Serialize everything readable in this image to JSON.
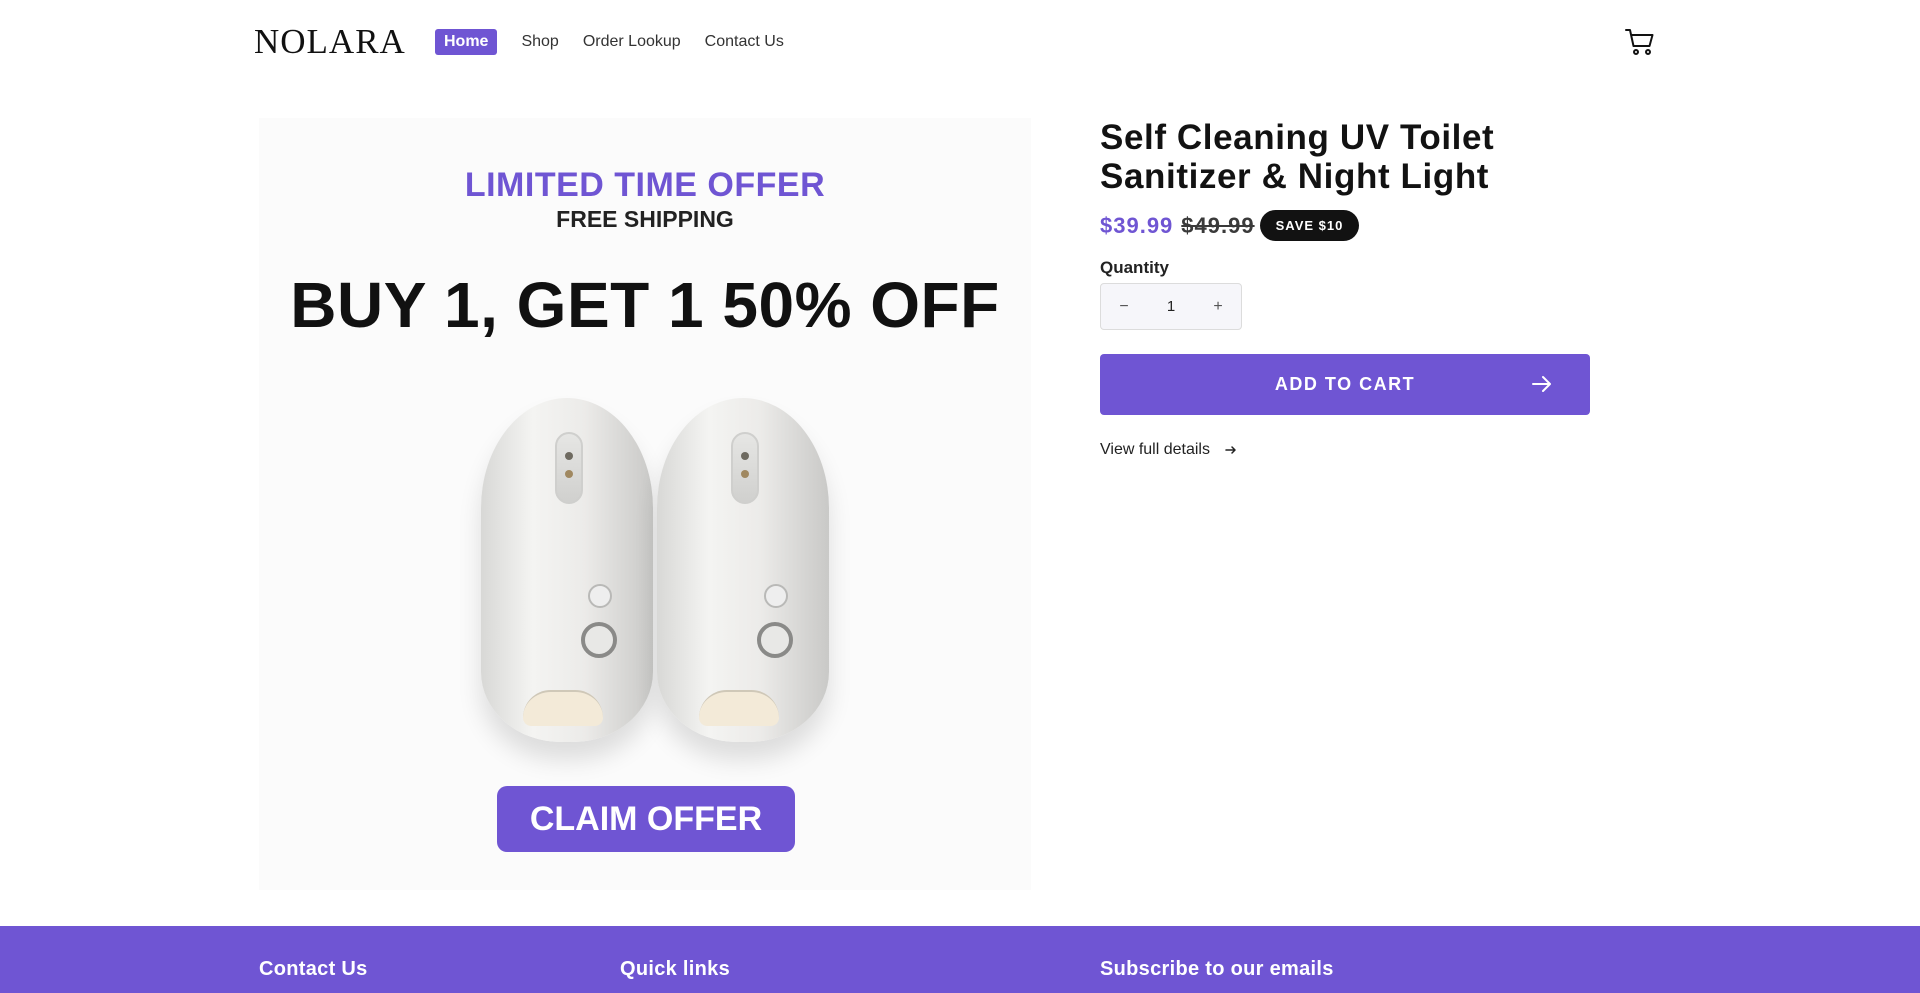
{
  "header": {
    "logo": "NOLARA",
    "nav": [
      {
        "label": "Home",
        "active": true
      },
      {
        "label": "Shop",
        "active": false
      },
      {
        "label": "Order Lookup",
        "active": false
      },
      {
        "label": "Contact Us",
        "active": false
      }
    ],
    "cart_icon": "shopping-cart-icon"
  },
  "product_image": {
    "line1": "LIMITED TIME OFFER",
    "line2": "FREE SHIPPING",
    "headline": "BUY 1, GET 1 50% OFF",
    "cta": "CLAIM OFFER"
  },
  "product": {
    "title": "Self Cleaning UV Toilet Sanitizer & Night Light",
    "price_sale": "$39.99",
    "price_regular": "$49.99",
    "badge": "SAVE $10",
    "quantity_label": "Quantity",
    "quantity_value": "1",
    "minus_symbol": "−",
    "plus_symbol": "+",
    "add_to_cart": "ADD TO CART",
    "view_details": "View full details"
  },
  "footer": {
    "headings": [
      "Contact Us",
      "Quick links",
      "Subscribe to our emails"
    ]
  },
  "colors": {
    "accent": "#6f55d3",
    "text": "#121212",
    "badge_bg": "#121212"
  }
}
